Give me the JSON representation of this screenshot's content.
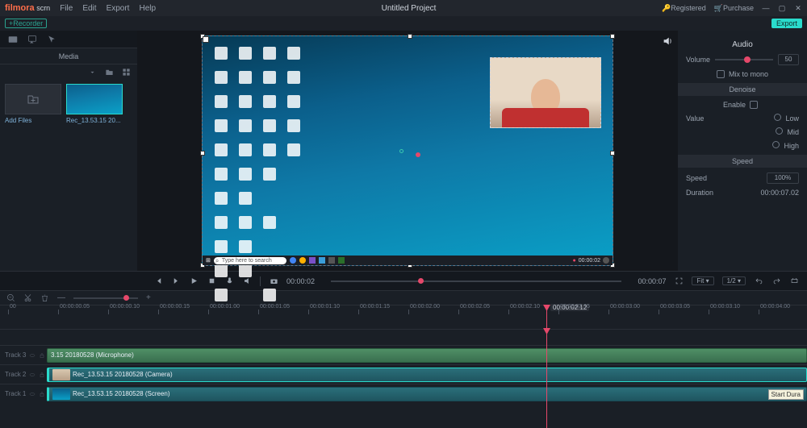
{
  "app": {
    "logo_main": "filmora",
    "logo_sub": " scrn",
    "title": "Untitled Project"
  },
  "menu": {
    "file": "File",
    "edit": "Edit",
    "export": "Export",
    "help": "Help"
  },
  "topright": {
    "registered": "Registered",
    "purchase": "Purchase"
  },
  "recorder": {
    "button": "+Recorder",
    "export": "Export"
  },
  "media": {
    "title": "Media",
    "add_files": "Add Files",
    "clip_label": "Rec_13.53.15 20..."
  },
  "audio": {
    "title": "Audio",
    "volume_label": "Volume",
    "volume_value": "50",
    "mix_to_mono": "Mix to mono"
  },
  "denoise": {
    "title": "Denoise",
    "enable": "Enable",
    "value": "Value",
    "low": "Low",
    "mid": "Mid",
    "high": "High"
  },
  "speed": {
    "title": "Speed",
    "speed_label": "Speed",
    "speed_value": "100%",
    "duration_label": "Duration",
    "duration_value": "00:00:07.02"
  },
  "transport": {
    "current": "00:00:02",
    "total": "00:00:07",
    "fit": "Fit",
    "scale": "1/2"
  },
  "preview": {
    "search_placeholder": "Type here to search",
    "rec_time": "00:00:02"
  },
  "timeline": {
    "playhead": "00:00:02.12",
    "ticks": [
      "00",
      "00:00:00.05",
      "00:00:00.10",
      "00:00:00.15",
      "00:00:01.00",
      "00:00:01.05",
      "00:00:01.10",
      "00:00:01.15",
      "00:00:02.00",
      "00:00:02.05",
      "00:00:02.10",
      "00:00:02.15",
      "00:00:03.00",
      "00:00:03.05",
      "00:00:03.10",
      "00:00:04.00"
    ]
  },
  "tracks": {
    "t3": {
      "name": "Track 3",
      "clip": "3.15 20180528 (Microphone)"
    },
    "t2": {
      "name": "Track 2",
      "clip": "Rec_13.53.15 20180528 (Camera)"
    },
    "t1": {
      "name": "Track 1",
      "clip": "Rec_13.53.15 20180528 (Screen)"
    }
  },
  "tooltip": "Start\nDura"
}
